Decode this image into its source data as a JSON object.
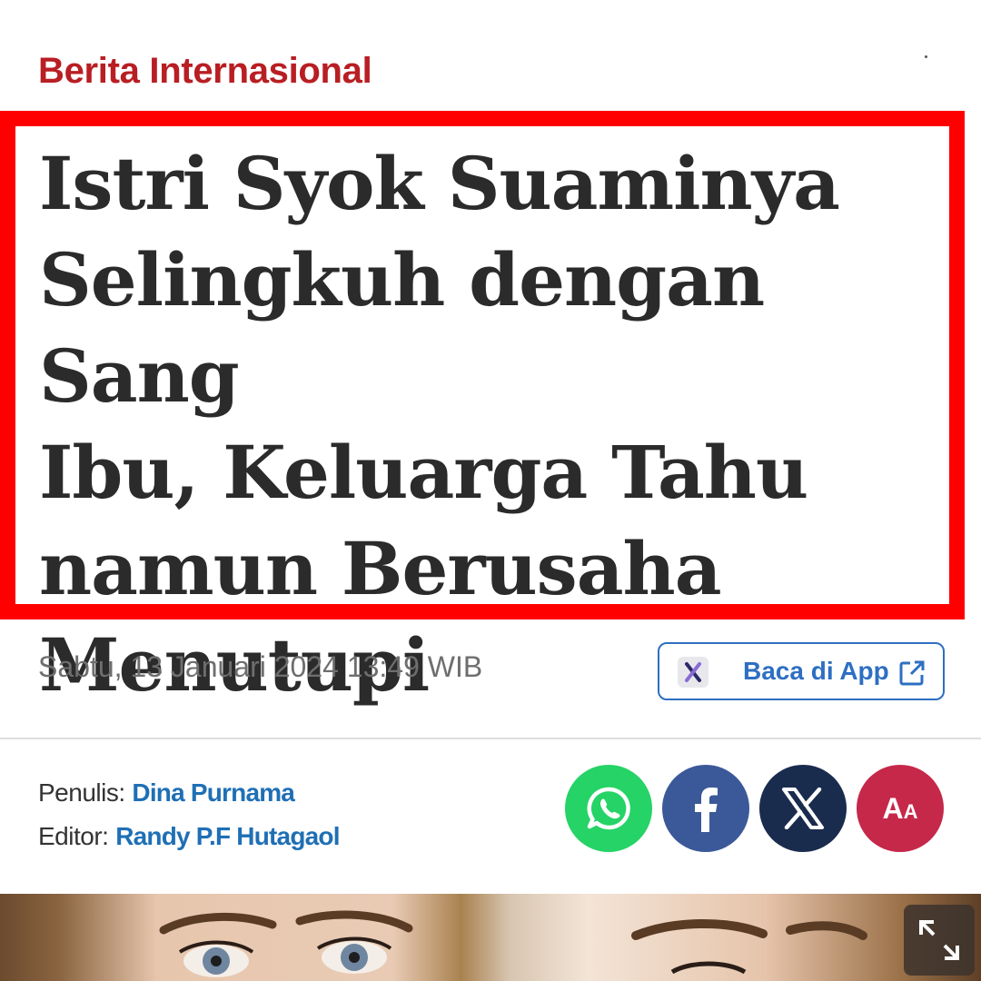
{
  "category": "Berita Internasional",
  "headline": {
    "lines": [
      "Istri Syok Suaminya",
      "Selingkuh dengan Sang",
      "Ibu, Keluarga Tahu",
      "namun Berusaha",
      "Menutupi"
    ],
    "highlight_color": "#ff0000"
  },
  "meta": {
    "date": "Sabtu, 13 Januari 2024 13:49 WIB"
  },
  "app_button": {
    "label": "Baca di App",
    "logo_icon": "x-app-logo-icon",
    "icon": "external-link-icon"
  },
  "byline": {
    "writer_label": "Penulis:",
    "writer_name": "Dina Purnama",
    "editor_label": "Editor:",
    "editor_name": "Randy P.F Hutagaol"
  },
  "share": {
    "buttons": [
      {
        "name": "whatsapp",
        "icon": "whatsapp-icon",
        "color": "#25d366"
      },
      {
        "name": "facebook",
        "icon": "facebook-icon",
        "color": "#3b5998"
      },
      {
        "name": "x",
        "icon": "x-icon",
        "color": "#1a2c4e"
      },
      {
        "name": "font-size",
        "icon": "font-size-icon",
        "color": "#c6284a"
      }
    ],
    "font_size_label_big": "A",
    "font_size_label_small": "A"
  },
  "colors": {
    "category": "#b81e23",
    "link": "#1f6fb5",
    "app_accent": "#2e6fc2"
  },
  "photo": {
    "expand_icon": "expand-icon"
  }
}
